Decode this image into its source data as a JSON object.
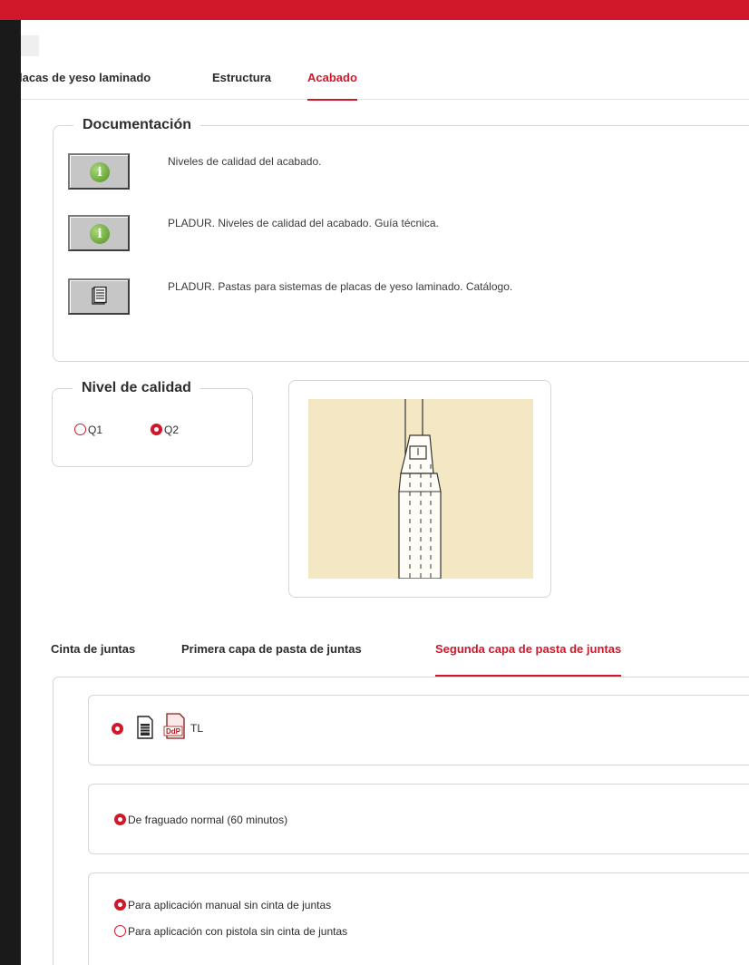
{
  "tabs": [
    {
      "label": "lacas de yeso laminado",
      "active": false
    },
    {
      "label": "Estructura",
      "active": false
    },
    {
      "label": "Acabado",
      "active": true
    }
  ],
  "documentacion": {
    "legend": "Documentación",
    "items": [
      {
        "icon": "info-icon",
        "text": "Niveles de calidad del acabado."
      },
      {
        "icon": "info-icon",
        "text": "PLADUR. Niveles de calidad del acabado. Guía técnica."
      },
      {
        "icon": "document-icon",
        "text": "PLADUR. Pastas para sistemas de placas de yeso laminado. Catálogo."
      }
    ]
  },
  "nivel": {
    "legend": "Nivel de calidad",
    "options": [
      {
        "label": "Q1",
        "selected": false
      },
      {
        "label": "Q2",
        "selected": true
      }
    ]
  },
  "subtabs": [
    {
      "label": "Cinta de juntas",
      "active": false
    },
    {
      "label": "Primera capa de pasta de juntas",
      "active": false
    },
    {
      "label": "Segunda capa de pasta de juntas",
      "active": true
    }
  ],
  "product": {
    "code": "TL",
    "pdf_badge": "DdP"
  },
  "fraguado": {
    "label": "De fraguado normal (60 minutos)",
    "selected": true
  },
  "aplicacion": [
    {
      "label": "Para aplicación manual sin cinta de juntas",
      "selected": true
    },
    {
      "label": "Para aplicación con pistola sin cinta de juntas",
      "selected": false
    }
  ],
  "colors": {
    "accent": "#d0182a",
    "illustration_bg": "#f4e8c4"
  }
}
